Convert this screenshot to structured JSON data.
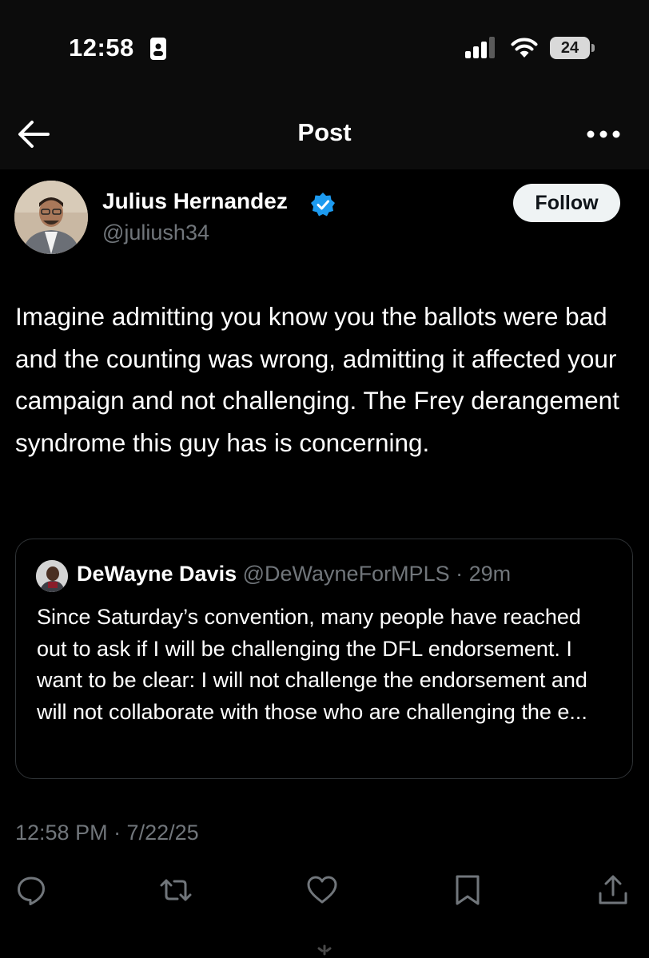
{
  "status_bar": {
    "time": "12:58",
    "battery": "24",
    "icons": [
      "id-badge-icon",
      "cellular-signal-icon",
      "wifi-icon",
      "battery-icon"
    ]
  },
  "header": {
    "title": "Post",
    "back_icon": "arrow-left-icon",
    "more_icon": "more-horizontal-icon"
  },
  "post": {
    "author_name": "Julius Hernandez",
    "author_handle": "@juliush34",
    "verified_icon": "verified-badge-icon",
    "follow_label": "Follow",
    "text": "Imagine admitting you know you the ballots were bad and the counting was wrong, admitting it affected your campaign and not challenging. The Frey derangement syndrome this guy has is concerning.",
    "timestamp": "12:58 PM · 7/22/25"
  },
  "quoted_post": {
    "author_name": "DeWayne Davis",
    "author_handle": "@DeWayneForMPLS",
    "time": "· 29m",
    "text": "Since Saturday’s convention, many people have reached out to ask if I will be challenging the DFL endorsement. I want to be clear: I will not challenge the endorsement and will not collaborate with those who are challenging the e..."
  },
  "actions": [
    "reply-icon",
    "repost-icon",
    "like-icon",
    "bookmark-icon",
    "share-icon"
  ],
  "colors": {
    "background": "#000000",
    "text": "#ffffff",
    "secondary_text": "#71767b",
    "verified": "#1d9bf0",
    "follow_button_bg": "#eff3f4",
    "border": "#2f3336"
  }
}
